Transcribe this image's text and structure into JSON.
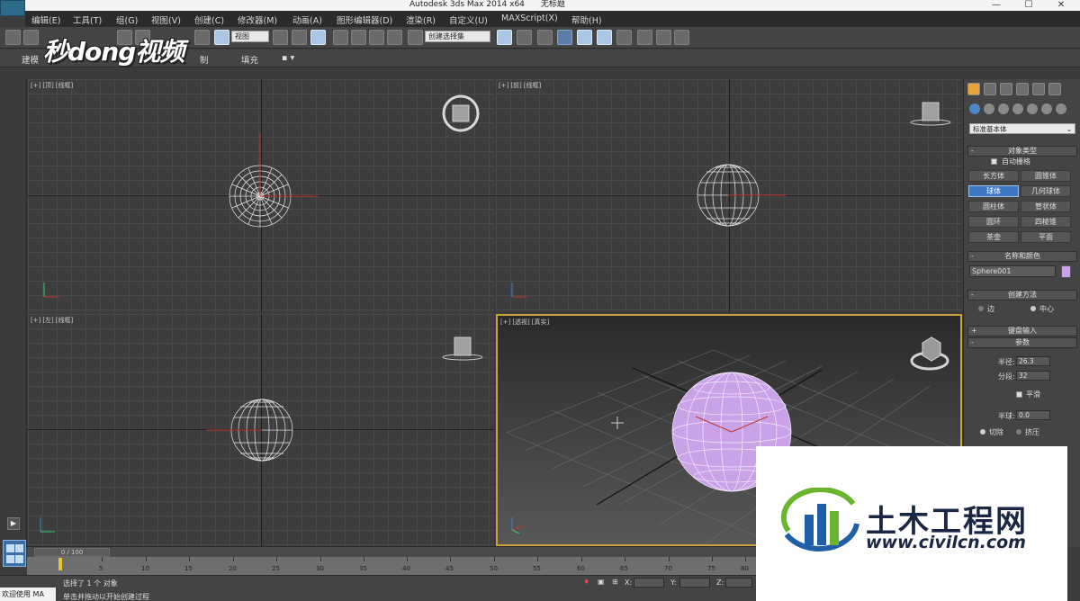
{
  "window": {
    "app_title": "Autodesk 3ds Max  2014 x64",
    "doc_title": "无标题",
    "minimize": "—",
    "maximize": "☐",
    "close": "✕"
  },
  "menu": [
    "编辑(E)",
    "工具(T)",
    "组(G)",
    "视图(V)",
    "创建(C)",
    "修改器(M)",
    "动画(A)",
    "图形编辑器(D)",
    "渲染(R)",
    "自定义(U)",
    "MAXScript(X)",
    "帮助(H)"
  ],
  "toolbar": {
    "ref_coord": "视图",
    "selection_set": "创建选择集"
  },
  "ribbon": {
    "tabs": [
      "建模",
      "填充"
    ],
    "partial_tab": "制"
  },
  "watermark": "秒dong视频",
  "viewports": {
    "top": {
      "labels": [
        "[+]",
        "[顶]",
        "[线框]"
      ]
    },
    "front": {
      "labels": [
        "[+]",
        "[前]",
        "[线框]"
      ]
    },
    "left": {
      "labels": [
        "[+]",
        "[左]",
        "[线框]"
      ]
    },
    "perspective": {
      "labels": [
        "[+]",
        "[透视]",
        "[真实]"
      ]
    }
  },
  "command_panel": {
    "category_dropdown": "标准基本体",
    "object_type": {
      "title": "对象类型",
      "autogrid_label": "自动栅格",
      "buttons": [
        "长方体",
        "圆锥体",
        "球体",
        "几何球体",
        "圆柱体",
        "管状体",
        "圆环",
        "四棱锥",
        "茶壶",
        "平面"
      ],
      "active_button": "球体"
    },
    "name_color": {
      "title": "名称和颜色",
      "name": "Sphere001",
      "color": "#c9a2e8"
    },
    "creation_method": {
      "title": "创建方法",
      "options": [
        "边",
        "中心"
      ],
      "selected": "中心"
    },
    "keyboard_entry": {
      "title": "键盘输入"
    },
    "parameters": {
      "title": "参数",
      "radius_label": "半径:",
      "radius": "26.3",
      "segments_label": "分段:",
      "segments": "32",
      "smooth_label": "平滑",
      "hemisphere_label": "半球:",
      "hemisphere": "0.0",
      "chop_label": "切除",
      "squash_label": "挤压"
    }
  },
  "timeline": {
    "slider": "0 / 100",
    "ticks": [
      "5",
      "10",
      "15",
      "20",
      "25",
      "30",
      "35",
      "40",
      "45",
      "50",
      "55",
      "60",
      "65",
      "70",
      "75",
      "80"
    ]
  },
  "status": {
    "selection": "选择了 1 个 对象",
    "prompt": "单击并拖动以开始创建过程",
    "maxscript_button": "欢迎使用 MA",
    "x_label": "X:",
    "y_label": "Y:",
    "z_label": "Z:"
  },
  "logo": {
    "cn_text": "土木工程网",
    "url": "www.civilcn.com",
    "colors": {
      "blue": "#1f5fa8",
      "green": "#6ab52e",
      "navy": "#1a2744"
    }
  }
}
